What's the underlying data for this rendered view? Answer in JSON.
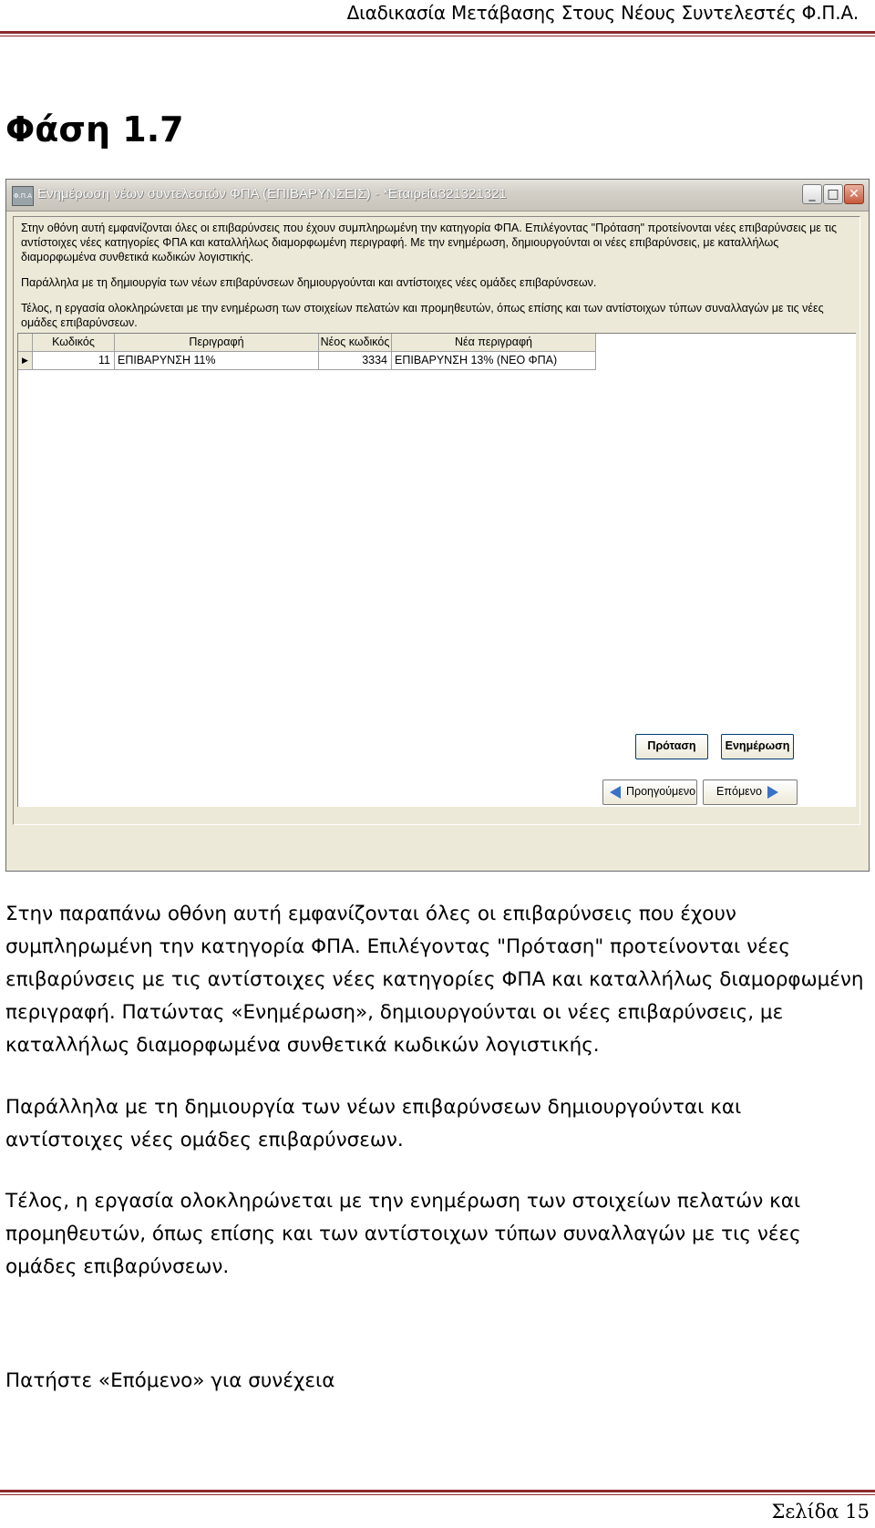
{
  "header": {
    "running_title": "Διαδικασία Μετάβασης Στους Νέους Συντελεστές Φ.Π.Α."
  },
  "phase_title": "Φάση 1.7",
  "window": {
    "title": "Ενημέρωση νέων συντελεστών ΦΠΑ (ΕΠΙΒΑΡΥΝΣΕΙΣ) - *Εταιρεία321321321",
    "app_icon_text": "Φ.Π.Α",
    "min_glyph": "_",
    "max_glyph": "□",
    "close_glyph": "✕",
    "info": [
      "Στην οθόνη αυτή εμφανίζονται όλες οι επιβαρύνσεις που έχουν συμπληρωμένη την κατηγορία ΦΠΑ. Επιλέγοντας \"Πρόταση\" προτείνονται νέες επιβαρύνσεις με τις αντίστοιχες νέες κατηγορίες ΦΠΑ και καταλλήλως διαμορφωμένη περιγραφή. Με την ενημέρωση, δημιουργούνται οι νέες επιβαρύνσεις, με καταλλήλως διαμορφωμένα συνθετικά κωδικών λογιστικής.",
      "Παράλληλα με τη δημιουργία των νέων επιβαρύνσεων δημιουργούνται και αντίστοιχες νέες ομάδες επιβαρύνσεων.",
      "Τέλος, η εργασία ολοκληρώνεται με την ενημέρωση των στοιχείων πελατών και προμηθευτών, όπως επίσης και των αντίστοιχων τύπων συναλλαγών με τις νέες ομάδες επιβαρύνσεων."
    ],
    "grid": {
      "columns": [
        "Κωδικός",
        "Περιγραφή",
        "Νέος κωδικός",
        "Νέα περιγραφή"
      ],
      "rows": [
        {
          "code": "11",
          "desc": "ΕΠΙΒΑΡΥΝΣΗ 11%",
          "new_code": "3334",
          "new_desc": "ΕΠΙΒΑΡΥΝΣΗ 13% (ΝΕΟ ΦΠΑ)"
        }
      ],
      "row_marker": "▶"
    },
    "buttons": {
      "proposal": "Πρόταση",
      "update": "Ενημέρωση",
      "previous": "Προηγούμενο",
      "next": "Επόμενο"
    }
  },
  "body": {
    "p1": "Στην παραπάνω οθόνη αυτή εμφανίζονται όλες οι επιβαρύνσεις που έχουν συμπληρωμένη την κατηγορία ΦΠΑ. Επιλέγοντας \"Πρόταση\" προτείνονται νέες  επιβαρύνσεις με τις αντίστοιχες νέες κατηγορίες ΦΠΑ και καταλλήλως διαμορφωμένη περιγραφή. Πατώντας «Ενημέρωση», δημιουργούνται οι νέες επιβαρύνσεις, με καταλλήλως διαμορφωμένα συνθετικά κωδικών λογιστικής.",
    "p2": "Παράλληλα με τη δημιουργία των νέων επιβαρύνσεων δημιουργούνται και αντίστοιχες νέες ομάδες επιβαρύνσεων.",
    "p3": "Τέλος, η εργασία ολοκληρώνεται με την ενημέρωση των στοιχείων πελατών και προμηθευτών, όπως επίσης και των αντίστοιχων τύπων συναλλαγών με τις νέες ομάδες επιβαρύνσεων.",
    "p4": "Πατήστε «Επόμενο» για συνέχεια"
  },
  "footer": {
    "page": "Σελίδα 15"
  },
  "colors": {
    "rule": "#8b2a2a",
    "window_face": "#ece9d8",
    "arrow": "#3a72c8"
  }
}
